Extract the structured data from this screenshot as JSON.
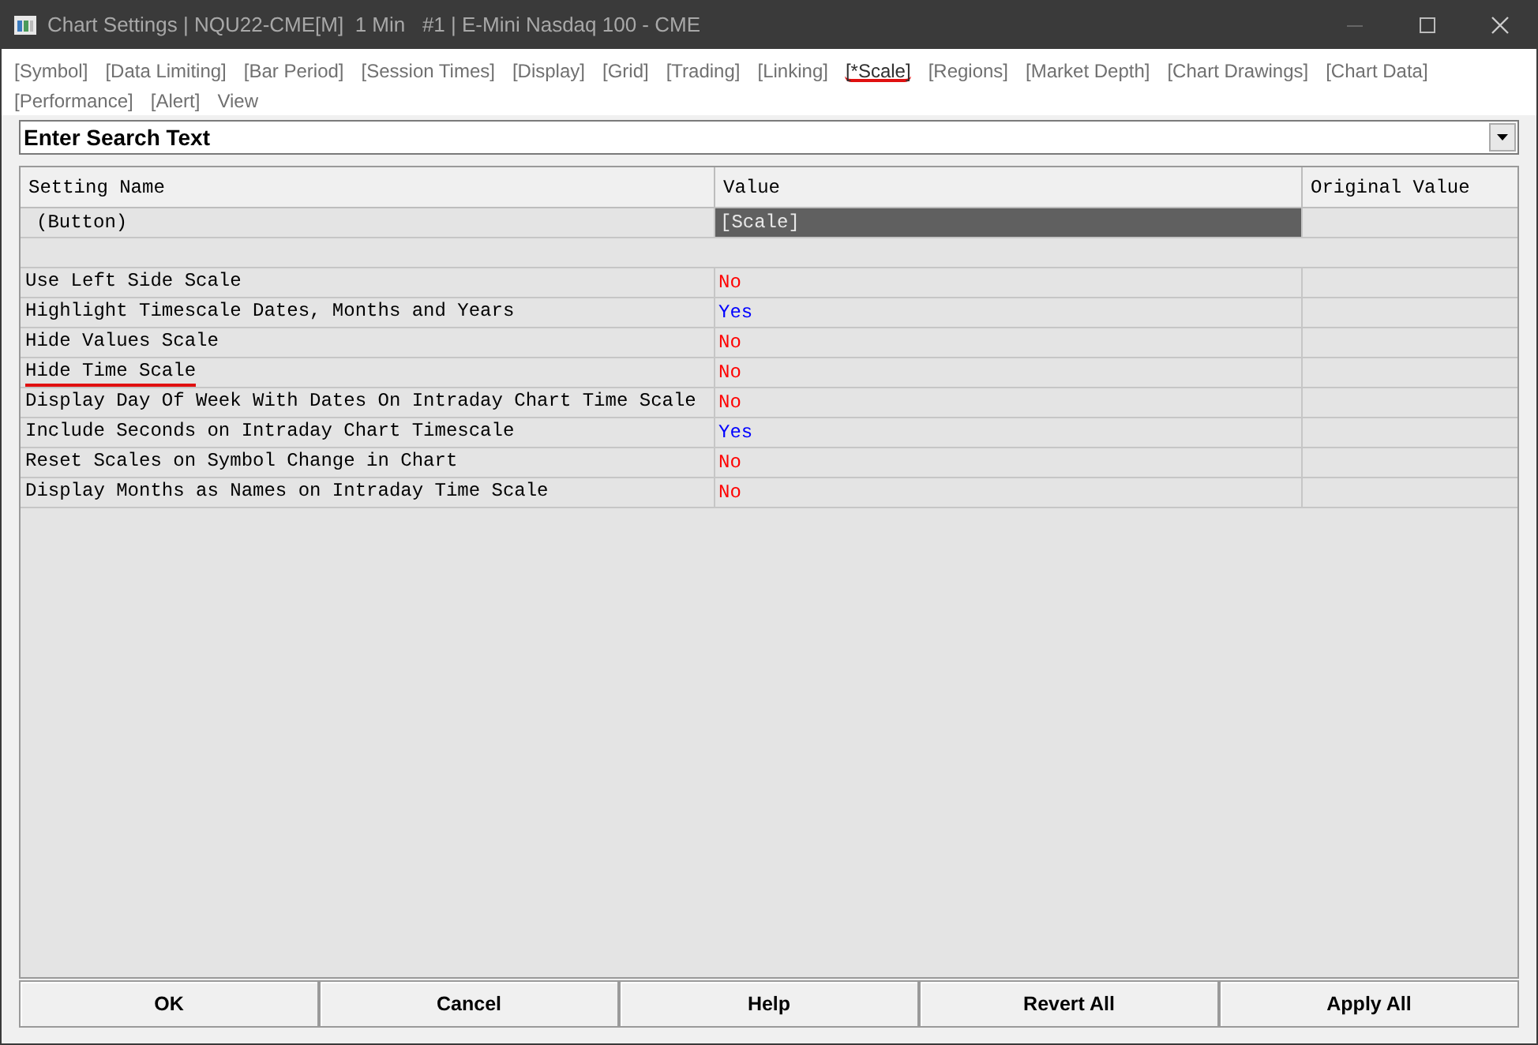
{
  "window": {
    "title": "Chart Settings | NQU22-CME[M]  1 Min   #1 | E-Mini Nasdaq 100 - CME"
  },
  "tabs": [
    {
      "label": "[Symbol]",
      "selected": false,
      "marked": false
    },
    {
      "label": "[Data Limiting]",
      "selected": false,
      "marked": false
    },
    {
      "label": "[Bar Period]",
      "selected": false,
      "marked": false
    },
    {
      "label": "[Session Times]",
      "selected": false,
      "marked": false
    },
    {
      "label": "[Display]",
      "selected": false,
      "marked": false
    },
    {
      "label": "[Grid]",
      "selected": false,
      "marked": false
    },
    {
      "label": "[Trading]",
      "selected": false,
      "marked": false
    },
    {
      "label": "[Linking]",
      "selected": false,
      "marked": false
    },
    {
      "label": "[*Scale]",
      "selected": true,
      "marked": true
    },
    {
      "label": "[Regions]",
      "selected": false,
      "marked": false
    },
    {
      "label": "[Market Depth]",
      "selected": false,
      "marked": false
    },
    {
      "label": "[Chart Drawings]",
      "selected": false,
      "marked": false
    },
    {
      "label": "[Chart Data]",
      "selected": false,
      "marked": false
    },
    {
      "label": "[Performance]",
      "selected": false,
      "marked": false
    },
    {
      "label": "[Alert]",
      "selected": false,
      "marked": false
    },
    {
      "label": "View",
      "selected": false,
      "marked": false
    }
  ],
  "search": {
    "value": "Enter Search Text"
  },
  "table": {
    "columns": [
      "Setting Name",
      "Value",
      "Original Value"
    ],
    "rows": [
      {
        "kind": "button",
        "name": "(Button)",
        "value": "[Scale]"
      },
      {
        "kind": "blank"
      },
      {
        "kind": "setting",
        "name": "Use Left Side Scale",
        "value": "No",
        "on": false,
        "marked": false
      },
      {
        "kind": "setting",
        "name": "Highlight Timescale Dates, Months and Years",
        "value": "Yes",
        "on": true,
        "marked": false
      },
      {
        "kind": "setting",
        "name": "Hide Values Scale",
        "value": "No",
        "on": false,
        "marked": false
      },
      {
        "kind": "setting",
        "name": "Hide Time Scale",
        "value": "No",
        "on": false,
        "marked": true
      },
      {
        "kind": "setting",
        "name": "Display Day Of Week With Dates On Intraday Chart Time Scale",
        "value": "No",
        "on": false,
        "marked": false
      },
      {
        "kind": "setting",
        "name": "Include Seconds on Intraday Chart Timescale",
        "value": "Yes",
        "on": true,
        "marked": false
      },
      {
        "kind": "setting",
        "name": "Reset Scales on Symbol Change in Chart",
        "value": "No",
        "on": false,
        "marked": false
      },
      {
        "kind": "setting",
        "name": "Display Months as Names on Intraday Time Scale",
        "value": "No",
        "on": false,
        "marked": false
      }
    ]
  },
  "buttons": [
    "OK",
    "Cancel",
    "Help",
    "Revert All",
    "Apply All"
  ]
}
